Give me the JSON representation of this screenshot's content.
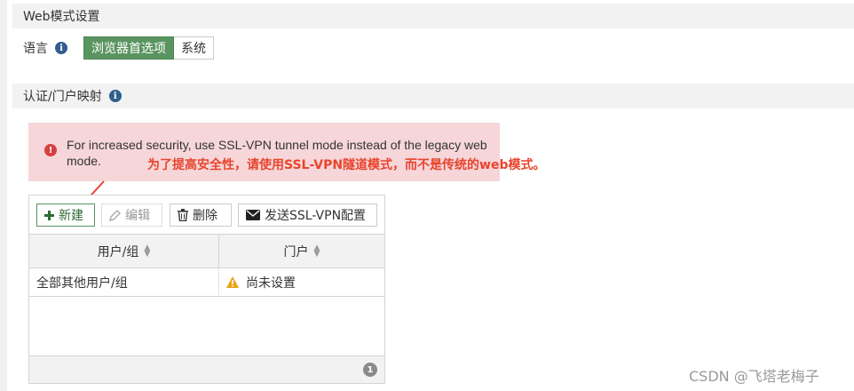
{
  "web_mode": {
    "title": "Web模式设置",
    "language_label": "语言",
    "language_options": [
      "浏览器首选项",
      "系统"
    ],
    "language_selected": "浏览器首选项"
  },
  "auth_mapping": {
    "title": "认证/门户映射"
  },
  "alert": {
    "text": "For increased security, use SSL-VPN tunnel mode instead of the legacy web mode.",
    "annotation": "为了提高安全性，请使用SSL-VPN隧道模式，而不是传统的web模式。"
  },
  "toolbar": {
    "new_label": "新建",
    "edit_label": "编辑",
    "delete_label": "删除",
    "send_label": "发送SSL-VPN配置"
  },
  "table": {
    "columns": [
      "用户/组",
      "门户"
    ],
    "rows": [
      {
        "user_group": "全部其他用户/组",
        "portal": "尚未设置"
      }
    ],
    "count": "1"
  },
  "watermark": "CSDN @飞塔老梅子",
  "colors": {
    "active_green": "#5a9461",
    "alert_bg": "#f6d6d9",
    "annotation_red": "#e8442c",
    "info_blue": "#2f5f8f"
  }
}
